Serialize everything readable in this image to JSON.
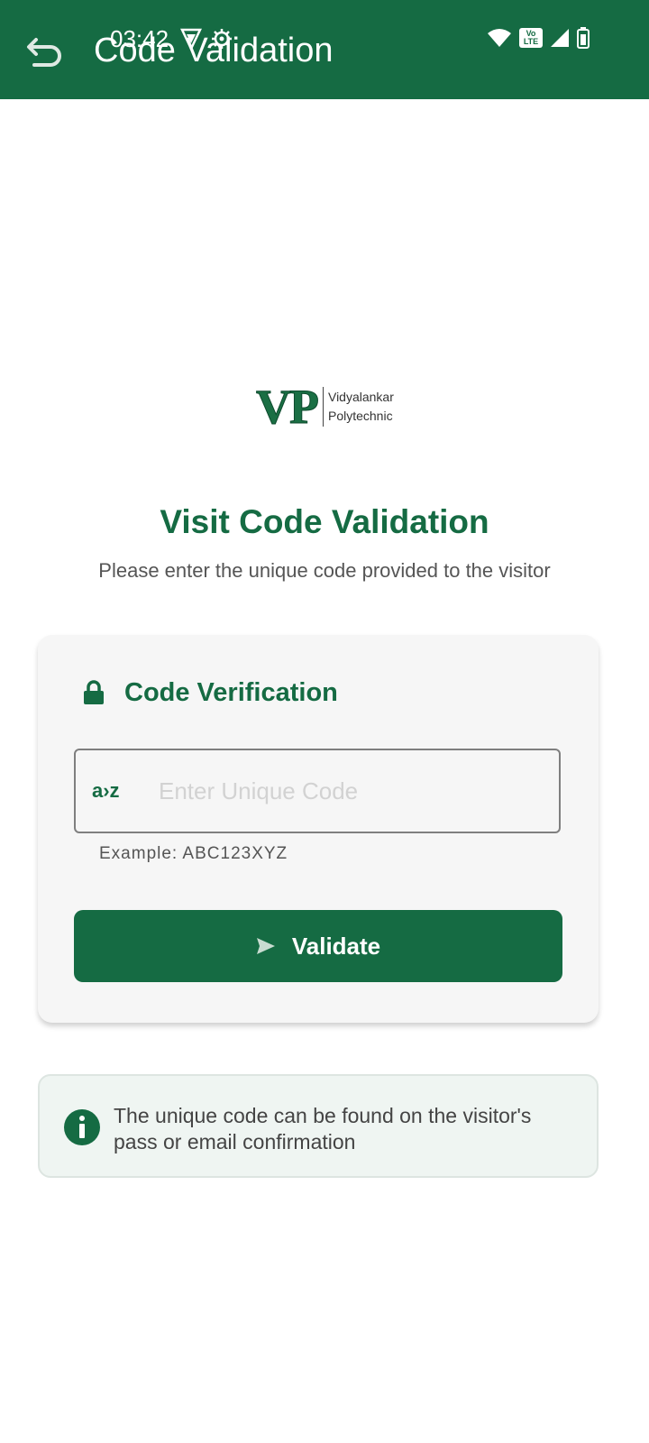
{
  "status_bar": {
    "time": "03:42",
    "network_label": "Vo LTE"
  },
  "appbar": {
    "title": "Code Validation",
    "back_icon": "undo-arrow-icon"
  },
  "logo": {
    "mark": "VP",
    "line1": "Vidyalankar",
    "line2": "Polytechnic"
  },
  "heading": "Visit Code Validation",
  "subheading": "Please enter the unique code provided to the visitor",
  "card": {
    "title": "Code Verification",
    "title_icon": "lock-icon",
    "input": {
      "prefix_icon": "a-to-z-icon",
      "prefix_text": "a›z",
      "placeholder": "Enter Unique Code",
      "value": ""
    },
    "example": "Example: ABC123XYZ",
    "button_label": "Validate",
    "button_icon": "send-icon"
  },
  "info": {
    "icon": "info-icon",
    "text": "The unique code can be found on the visitor's pass or email confirmation"
  },
  "colors": {
    "primary": "#156b43",
    "card_bg": "#f6f6f6",
    "info_bg": "#eff5f2"
  }
}
